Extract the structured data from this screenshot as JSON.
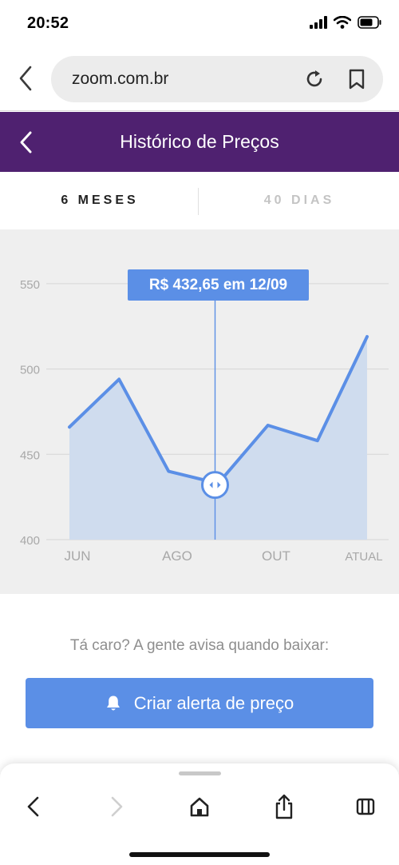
{
  "status_bar": {
    "time": "20:52"
  },
  "browser": {
    "url": "zoom.com.br"
  },
  "header": {
    "title": "Histórico de Preços"
  },
  "tabs": [
    {
      "label": "6 MESES",
      "active": true
    },
    {
      "label": "40 DIAS",
      "active": false
    }
  ],
  "tooltip": {
    "text": "R$ 432,65 em 12/09"
  },
  "chart_data": {
    "type": "area",
    "x_tick_labels": [
      "JUN",
      "AGO",
      "OUT",
      "ATUAL"
    ],
    "y_ticks": [
      400,
      450,
      500,
      550
    ],
    "ylim": [
      400,
      560
    ],
    "values": [
      466,
      494,
      440,
      433,
      467,
      458,
      519
    ],
    "highlight_index": 3,
    "grid": true,
    "line_color": "#5b8fe6",
    "fill_color": "#cfdcee"
  },
  "alert": {
    "prompt": "Tá caro? A gente avisa quando baixar:",
    "button_label": "Criar alerta de preço",
    "icon": "bell-icon"
  },
  "toolbar": {
    "icons": [
      "back-icon",
      "forward-icon",
      "home-icon",
      "share-icon",
      "tabs-icon"
    ]
  },
  "colors": {
    "header": "#4f2170",
    "accent": "#5b8fe6"
  }
}
